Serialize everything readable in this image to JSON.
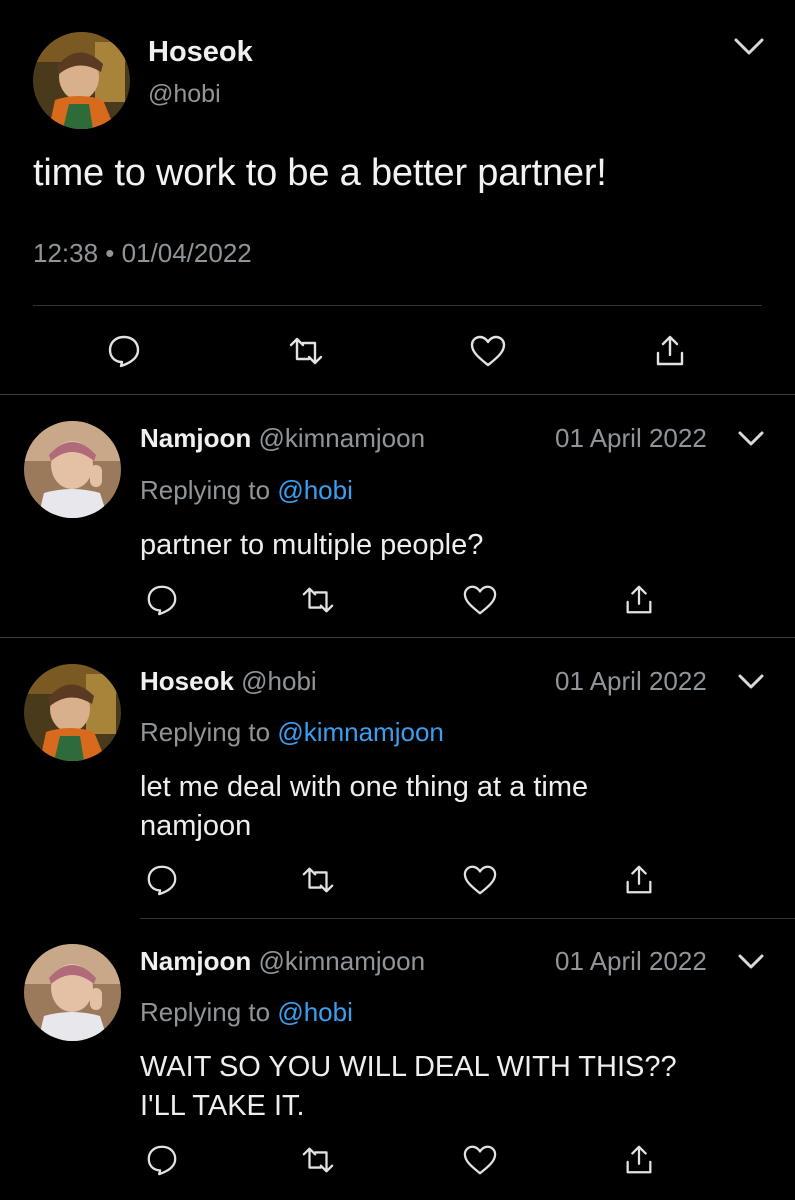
{
  "main_tweet": {
    "name": "Hoseok",
    "handle": "@hobi",
    "text": "time to work to be a better partner!",
    "timestamp": "12:38 • 01/04/2022",
    "actions": [
      "reply-icon",
      "retweet-icon",
      "like-icon",
      "share-icon"
    ]
  },
  "replies": [
    {
      "name": "Namjoon",
      "handle": "@kimnamjoon",
      "date": "01 April 2022",
      "replying_prefix": "Replying to ",
      "replying_to": "@hobi",
      "text_lines": [
        "partner to multiple people?"
      ]
    },
    {
      "name": "Hoseok",
      "handle": "@hobi",
      "date": "01 April 2022",
      "replying_prefix": "Replying to ",
      "replying_to": "@kimnamjoon",
      "text_lines": [
        "let me deal with one thing at a time",
        "namjoon"
      ]
    },
    {
      "name": "Namjoon",
      "handle": "@kimnamjoon",
      "date": "01 April 2022",
      "replying_prefix": "Replying to ",
      "replying_to": "@hobi",
      "text_lines": [
        "WAIT SO YOU WILL DEAL WITH THIS??",
        "I'LL TAKE IT."
      ]
    }
  ],
  "colors": {
    "background": "#000000",
    "link": "#3a9ff0",
    "secondary_text": "#8f9599",
    "primary_text": "#f0f0f0"
  }
}
